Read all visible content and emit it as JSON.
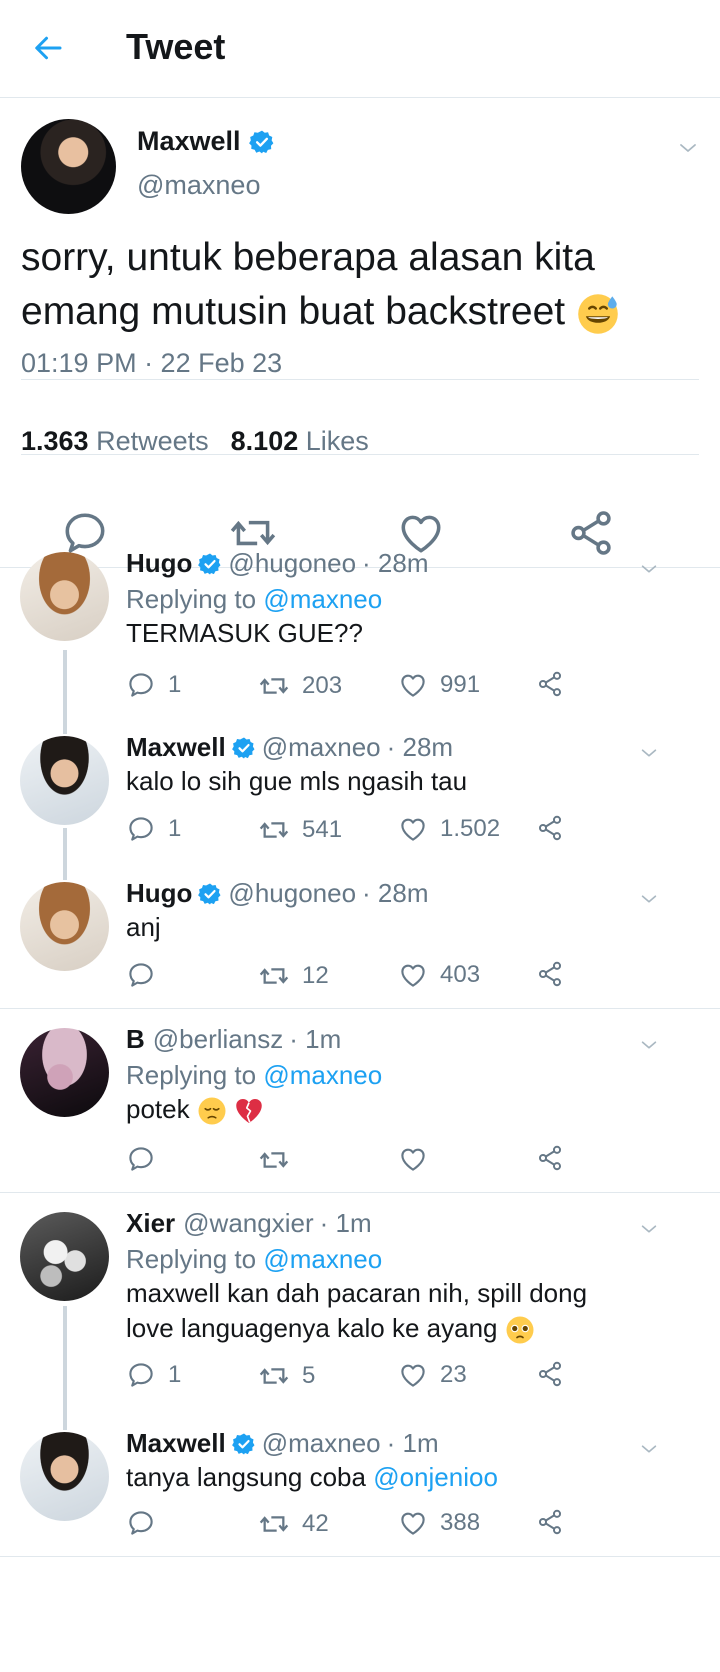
{
  "header": {
    "title": "Tweet"
  },
  "main_tweet": {
    "name": "Maxwell",
    "handle": "@maxneo",
    "text": "sorry, untuk beberapa alasan kita emang mutusin buat backstreet",
    "emoji": "grinning-sweat-emoji",
    "timestamp": "01:19 PM · 22 Feb 23",
    "retweets_count": "1.363",
    "retweets_label": "Retweets",
    "likes_count": "8.102",
    "likes_label": "Likes"
  },
  "replies": [
    {
      "name": "Hugo",
      "verified": true,
      "handle": "@hugoneo",
      "time": "· 28m",
      "replying_prefix": "Replying to",
      "replying_to": "@maxneo",
      "text": "TERMASUK GUE??",
      "replies": "1",
      "retweets": "203",
      "likes": "991"
    },
    {
      "name": "Maxwell",
      "verified": true,
      "handle": "@maxneo",
      "time": "· 28m",
      "text": "kalo lo sih gue mls ngasih tau",
      "replies": "1",
      "retweets": "541",
      "likes": "1.502"
    },
    {
      "name": "Hugo",
      "verified": true,
      "handle": "@hugoneo",
      "time": "· 28m",
      "text": "anj",
      "replies": "",
      "retweets": "12",
      "likes": "403"
    },
    {
      "name": "B",
      "verified": false,
      "handle": "@berliansz",
      "time": "· 1m",
      "replying_prefix": "Replying to",
      "replying_to": "@maxneo",
      "text": "potek",
      "emojis": [
        "pensive-face-emoji",
        "broken-heart-emoji"
      ],
      "replies": "",
      "retweets": "",
      "likes": ""
    },
    {
      "name": "Xier",
      "verified": false,
      "handle": "@wangxier",
      "time": "· 1m",
      "replying_prefix": "Replying to",
      "replying_to": "@maxneo",
      "text": "maxwell kan dah pacaran nih, spill dong love languagenya kalo ke ayang",
      "emoji": "pleading-face-emoji",
      "replies": "1",
      "retweets": "5",
      "likes": "23"
    },
    {
      "name": "Maxwell",
      "verified": true,
      "handle": "@maxneo",
      "time": "· 1m",
      "text": "tanya langsung coba",
      "mention": "@onjenioo",
      "replies": "",
      "retweets": "42",
      "likes": "388"
    }
  ],
  "colors": {
    "accent": "#1da1f2",
    "muted": "#657786",
    "text": "#14171a",
    "divider": "#e1e8ed"
  }
}
